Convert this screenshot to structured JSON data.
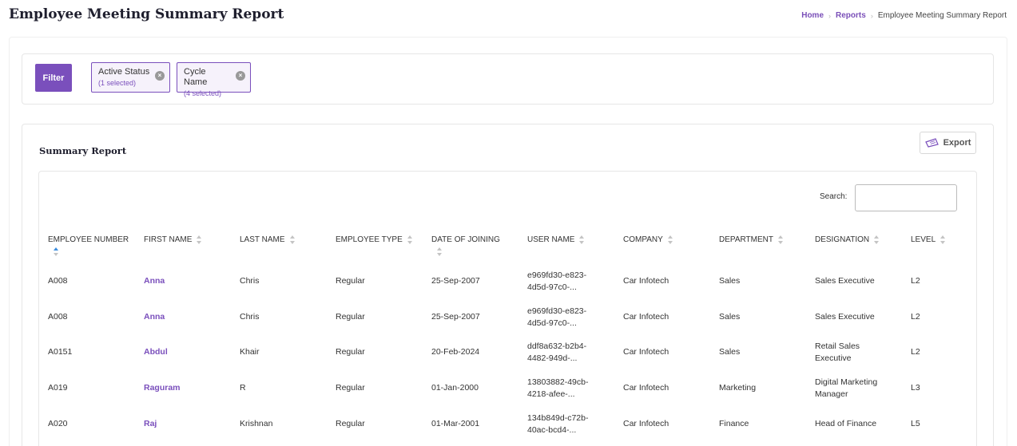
{
  "page": {
    "title": "Employee Meeting Summary Report"
  },
  "breadcrumb": {
    "home": "Home",
    "reports": "Reports",
    "current": "Employee Meeting Summary Report",
    "separator": "›"
  },
  "filters": {
    "button_label": "Filter",
    "chips": [
      {
        "title": "Active Status",
        "subtitle": "(1 selected)"
      },
      {
        "title": "Cycle Name",
        "subtitle": "(4 selected)"
      }
    ],
    "close_glyph": "×"
  },
  "report": {
    "title": "Summary Report",
    "export_label": "Export",
    "search_label": "Search:",
    "search_value": "",
    "columns": [
      "EMPLOYEE NUMBER",
      "FIRST NAME",
      "LAST NAME",
      "EMPLOYEE TYPE",
      "DATE OF JOINING",
      "USER NAME",
      "COMPANY",
      "DEPARTMENT",
      "DESIGNATION",
      "LEVEL"
    ],
    "rows": [
      {
        "employee_number": "A008",
        "first_name": "Anna",
        "last_name": "Chris",
        "employee_type": "Regular",
        "date_of_joining": "25-Sep-2007",
        "user_name_1": "e969fd30-e823-",
        "user_name_2": "4d5d-97c0-...",
        "company": "Car Infotech",
        "department": "Sales",
        "designation_1": "Sales Executive",
        "designation_2": "",
        "level": "L2"
      },
      {
        "employee_number": "A008",
        "first_name": "Anna",
        "last_name": "Chris",
        "employee_type": "Regular",
        "date_of_joining": "25-Sep-2007",
        "user_name_1": "e969fd30-e823-",
        "user_name_2": "4d5d-97c0-...",
        "company": "Car Infotech",
        "department": "Sales",
        "designation_1": "Sales Executive",
        "designation_2": "",
        "level": "L2"
      },
      {
        "employee_number": "A0151",
        "first_name": "Abdul",
        "last_name": "Khair",
        "employee_type": "Regular",
        "date_of_joining": "20-Feb-2024",
        "user_name_1": "ddf8a632-b2b4-",
        "user_name_2": "4482-949d-...",
        "company": "Car Infotech",
        "department": "Sales",
        "designation_1": "Retail Sales",
        "designation_2": "Executive",
        "level": "L2"
      },
      {
        "employee_number": "A019",
        "first_name": "Raguram",
        "last_name": "R",
        "employee_type": "Regular",
        "date_of_joining": "01-Jan-2000",
        "user_name_1": "13803882-49cb-",
        "user_name_2": "4218-afee-...",
        "company": "Car Infotech",
        "department": "Marketing",
        "designation_1": "Digital Marketing",
        "designation_2": "Manager",
        "level": "L3"
      },
      {
        "employee_number": "A020",
        "first_name": "Raj",
        "last_name": "Krishnan",
        "employee_type": "Regular",
        "date_of_joining": "01-Mar-2001",
        "user_name_1": "134b849d-c72b-",
        "user_name_2": "40ac-bcd4-...",
        "company": "Car Infotech",
        "department": "Finance",
        "designation_1": "Head of Finance",
        "designation_2": "",
        "level": "L5"
      }
    ]
  },
  "icons": {
    "export": "export-ticket-icon",
    "sort": "sort-both-icon",
    "sort_active": "sort-ascending-icon",
    "chip_close": "close-circle-icon"
  },
  "colors": {
    "accent": "#7a4fbc",
    "sort_active": "#3c8dde",
    "chip_background": "#f6f2fb"
  }
}
